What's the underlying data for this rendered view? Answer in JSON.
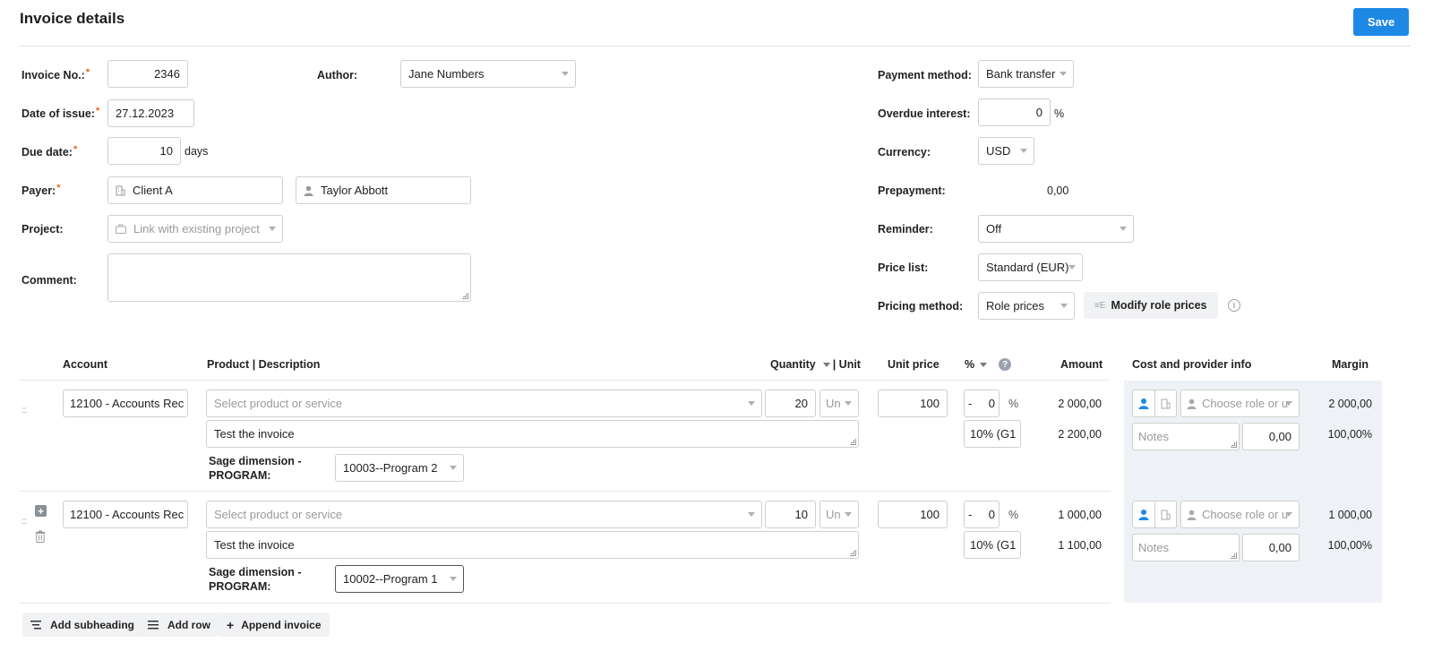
{
  "header": {
    "title": "Invoice details",
    "save_label": "Save"
  },
  "form": {
    "invoice_no_label": "Invoice No.:",
    "invoice_no": "2346",
    "date_issue_label": "Date of issue:",
    "date_issue": "27.12.2023",
    "due_date_label": "Due date:",
    "due_days": "10",
    "days_label": "days",
    "payer_label": "Payer:",
    "payer_company": "Client A",
    "payer_person": "Taylor Abbott",
    "project_label": "Project:",
    "project_placeholder": "Link with existing project",
    "comment_label": "Comment:",
    "author_label": "Author:",
    "author": "Jane Numbers",
    "required_mark": "*",
    "payment_method_label": "Payment method:",
    "payment_method": "Bank transfer",
    "overdue_label": "Overdue interest:",
    "overdue_value": "0",
    "percent": "%",
    "currency_label": "Currency:",
    "currency": "USD",
    "prepayment_label": "Prepayment:",
    "prepayment_value": "0,00",
    "reminder_label": "Reminder:",
    "reminder": "Off",
    "price_list_label": "Price list:",
    "price_list": "Standard (EUR)",
    "pricing_method_label": "Pricing method:",
    "pricing_method": "Role prices",
    "modify_role_prices": "Modify role prices",
    "modify_icon_glyph": "≡E",
    "info_glyph": "i"
  },
  "table": {
    "headers": {
      "account": "Account",
      "product": "Product | Description",
      "quantity": "Quantity",
      "unit": "| Unit",
      "unit_price": "Unit price",
      "percent": "%",
      "help_glyph": "?",
      "amount": "Amount",
      "cost": "Cost and provider info",
      "margin": "Margin"
    },
    "product_placeholder": "Select product or service",
    "role_placeholder": "Choose role or u",
    "notes_placeholder": "Notes",
    "sage_label_1": "Sage dimension -",
    "sage_label_2": "PROGRAM:",
    "rows": [
      {
        "account": "12100 - Accounts Rec",
        "quantity": "20",
        "unit": "Un",
        "unit_price": "100",
        "discount_sign": "-",
        "discount": "0",
        "tax": "10% (G1",
        "description": "Test the invoice",
        "program": "10003--Program 2",
        "amount": "2 000,00",
        "amount_tax": "2 200,00",
        "cost": "0,00",
        "margin": "2 000,00",
        "margin_pct": "100,00%"
      },
      {
        "account": "12100 - Accounts Rec",
        "quantity": "10",
        "unit": "Un",
        "unit_price": "100",
        "discount_sign": "-",
        "discount": "0",
        "tax": "10% (G1",
        "description": "Test the invoice",
        "program": "10002--Program 1",
        "amount": "1 000,00",
        "amount_tax": "1 100,00",
        "cost": "0,00",
        "margin": "1 000,00",
        "margin_pct": "100,00%"
      }
    ]
  },
  "footer": {
    "add_subheading": "Add subheading",
    "add_row": "Add row",
    "append_invoice": "Append invoice",
    "plus_glyph": "+"
  },
  "colors": {
    "accent": "#1e88e5",
    "required": "#e8661e",
    "cost_bg": "#eef1f5"
  }
}
